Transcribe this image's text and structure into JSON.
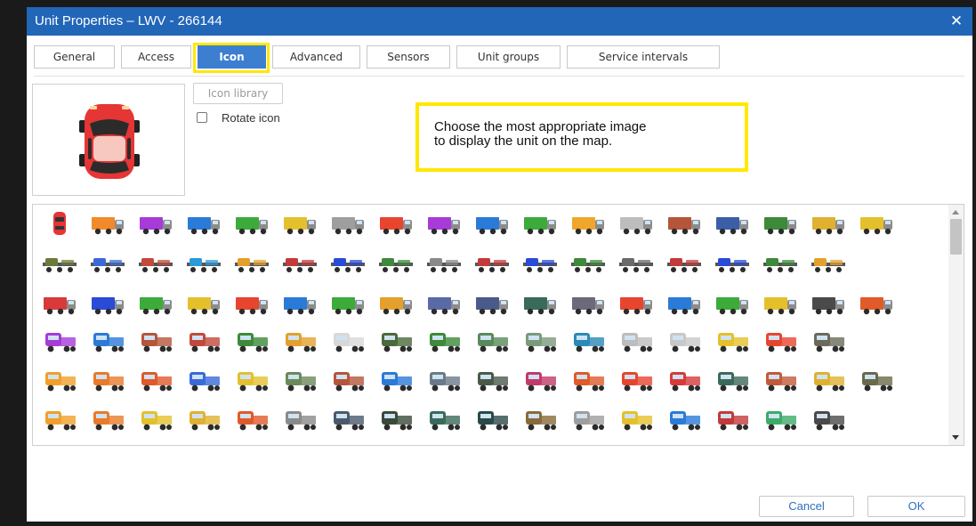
{
  "window": {
    "title": "Unit Properties – LWV - 266144",
    "close_glyph": "✕"
  },
  "tabs": [
    {
      "label": "General",
      "active": false
    },
    {
      "label": "Access",
      "active": false
    },
    {
      "label": "Icon",
      "active": true
    },
    {
      "label": "Advanced",
      "active": false
    },
    {
      "label": "Sensors",
      "active": false
    },
    {
      "label": "Unit groups",
      "active": false
    },
    {
      "label": "Service intervals",
      "active": false
    }
  ],
  "icon_panel": {
    "library_button": "Icon library",
    "rotate_label": "Rotate icon",
    "rotate_checked": false
  },
  "tooltip": {
    "line1": "Choose the most appropriate image",
    "line2": "to display the unit on the map."
  },
  "footer": {
    "cancel": "Cancel",
    "ok": "OK"
  },
  "colors": {
    "titlebar": "#2266b8",
    "active_tab": "#3c7fd0",
    "highlight": "#ffe800",
    "button_text": "#2f6fbf"
  },
  "icon_grid": {
    "rows": [
      [
        "#e8452f",
        "#f08a2a",
        "#a63bd8",
        "#2a7bd8",
        "#3cab3a",
        "#e4c02c",
        "#9e9e9e",
        "#e8452f",
        "#a63bd8",
        "#2a7bd8",
        "#3cab3a",
        "#f0a62a",
        "#bdbdbd",
        "#b5553a",
        "#3a5fa6",
        "#3c8a3a",
        "#e0b030",
        "#e4c02c"
      ],
      [
        "#6a7a3a",
        "#3a6ad8",
        "#c24a3a",
        "#2a9ad8",
        "#e4a02c",
        "#c23a3a",
        "#2a4ad8",
        "#3c8a3a",
        "#8a8a8a",
        "#c23a3a",
        "#2a4ad8",
        "#3c8a3a",
        "#6a6a6a",
        "#c23a3a",
        "#2a4ad8",
        "#3c8a3a",
        "#e4a02c"
      ],
      [
        "#d83a3a",
        "#2a4ad8",
        "#3cab3a",
        "#e4c02c",
        "#e8452f",
        "#2a7bd8",
        "#3cab3a",
        "#e4a02c",
        "#5a6aa6",
        "#4a5a8a",
        "#3a6a5a",
        "#6a6a7a",
        "#e8452f",
        "#2a7bd8",
        "#3cab3a",
        "#e4c02c",
        "#4a4a4a",
        "#e05a2a"
      ],
      [
        "#a63bd8",
        "#2a7bd8",
        "#b5553a",
        "#c24a3a",
        "#3c8a3a",
        "#e4a02c",
        "#d8d8d8",
        "#4a6a3a",
        "#3c8a3a",
        "#5a8a5a",
        "#7a9a7a",
        "#2a8ab8",
        "#bdbdbd",
        "#c8c8c8",
        "#e4c02c",
        "#e8452f",
        "#6a6a5a"
      ],
      [
        "#f0a02a",
        "#e87a2a",
        "#e05a2a",
        "#3a6ad8",
        "#e4c02c",
        "#6a8a5a",
        "#b5553a",
        "#2a7bd8",
        "#6a7a8a",
        "#4a5a4a",
        "#c23a6a",
        "#e05a2a",
        "#e8452f",
        "#d83a3a",
        "#3c6a5a",
        "#c25a3a",
        "#e0b030",
        "#6a6a4a"
      ],
      [
        "#f0a02a",
        "#e87a2a",
        "#e4c02c",
        "#e0b030",
        "#e05a2a",
        "#8a8a8a",
        "#4a5a6a",
        "#3a4a3a",
        "#3a6a5a",
        "#2a4a4a",
        "#8a6a3a",
        "#9e9e9e",
        "#e4c02c",
        "#2a7bd8",
        "#c23a3a",
        "#3cab6a",
        "#4a4a4a"
      ],
      [
        "#e8452f",
        "#aaaaaa",
        "#e0b030",
        "#cccccc",
        "#aaaaaa",
        "#c8c8c8",
        "#e4c02c",
        "#bbbbbb"
      ]
    ]
  }
}
